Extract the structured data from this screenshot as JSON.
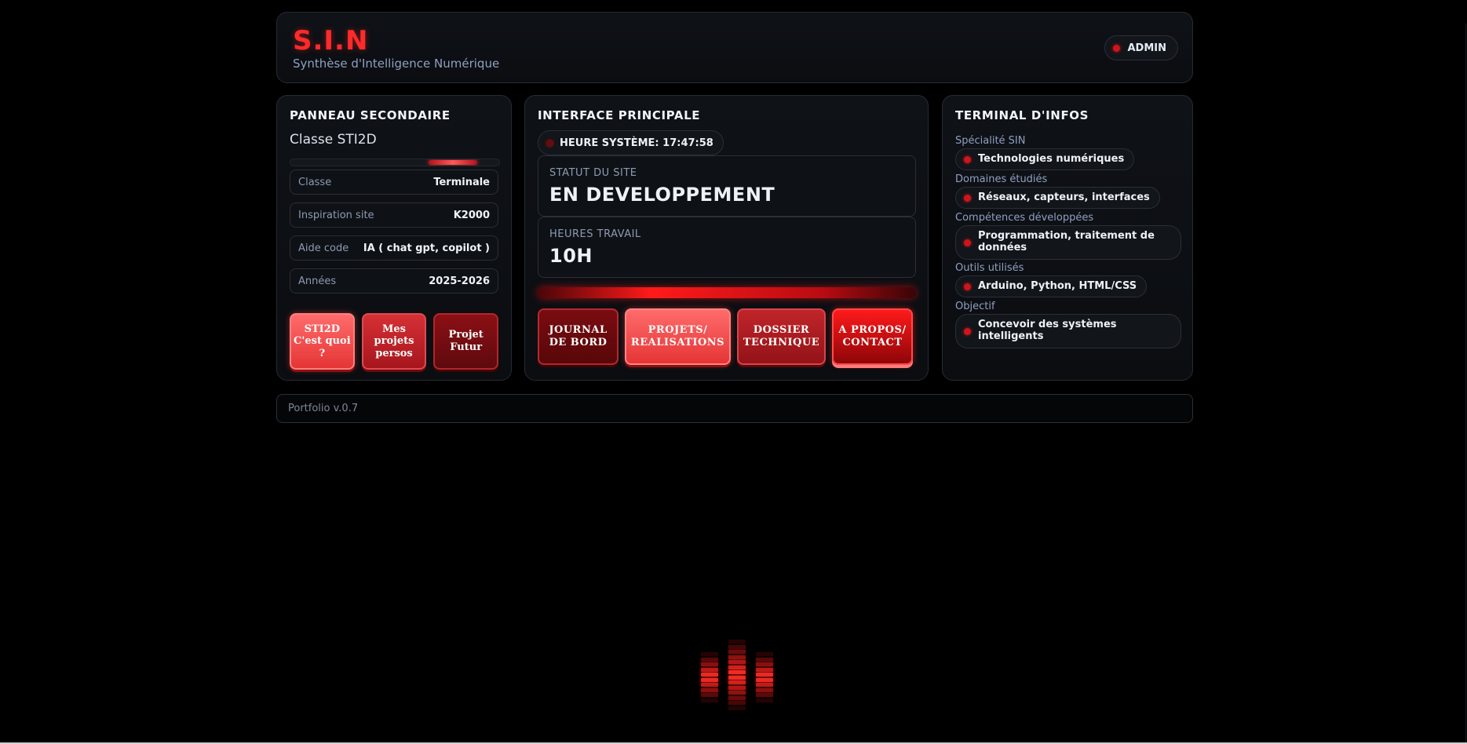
{
  "header": {
    "brand": "S.I.N",
    "tagline": "Synthèse d'Intelligence Numérique",
    "admin_label": "ADMIN"
  },
  "left_panel": {
    "title": "PANNEAU SECONDAIRE",
    "subtitle": "Classe STI2D",
    "rows": [
      {
        "key": "Classe",
        "value": "Terminale"
      },
      {
        "key": "Inspiration site",
        "value": "K2000"
      },
      {
        "key": "Aide code",
        "value": "IA ( chat gpt, copilot )"
      },
      {
        "key": "Années",
        "value": "2025-2026"
      }
    ],
    "buttons": [
      {
        "label": "STI2D C'est quoi ?"
      },
      {
        "label": "Mes projets persos"
      },
      {
        "label": "Projet Futur"
      }
    ]
  },
  "main_panel": {
    "title": "INTERFACE PRINCIPALE",
    "clock_label": "HEURE SYSTÈME: 17:47:58",
    "status": {
      "label": "STATUT DU SITE",
      "value": "EN DEVELOPPEMENT"
    },
    "hours": {
      "label": "HEURES TRAVAIL",
      "value": "10H"
    },
    "buttons": [
      {
        "label": "JOURNAL DE BORD"
      },
      {
        "label": "PROJETS/ REALISATIONS"
      },
      {
        "label": "DOSSIER TECHNIQUE"
      },
      {
        "label": "A PROPOS/ CONTACT"
      }
    ]
  },
  "terminal": {
    "title": "TERMINAL D'INFOS",
    "items": [
      {
        "label": "Spécialité SIN",
        "value": "Technologies numériques"
      },
      {
        "label": "Domaines étudiés",
        "value": "Réseaux, capteurs, interfaces"
      },
      {
        "label": "Compétences développées",
        "value": "Programmation, traitement de données"
      },
      {
        "label": "Outils utilisés",
        "value": "Arduino, Python, HTML/CSS"
      },
      {
        "label": "Objectif",
        "value": "Concevoir des systèmes intelligents"
      }
    ]
  },
  "footer": {
    "version": "Portfolio v.0.7"
  },
  "colors": {
    "accent": "#ff2a2a",
    "background": "#000000",
    "panel": "#0f1217"
  }
}
